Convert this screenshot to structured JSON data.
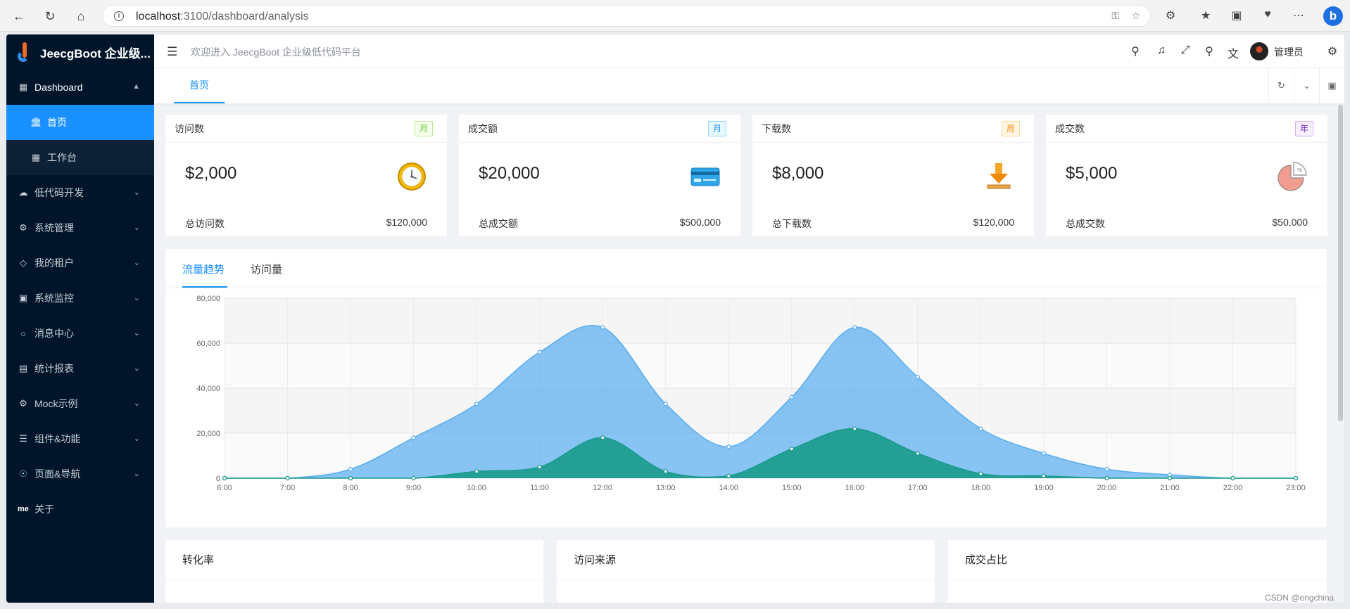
{
  "browser": {
    "url_host": "localhost",
    "url_path": ":3100/dashboard/analysis"
  },
  "app": {
    "title": "JeecgBoot 企业级...",
    "welcome": "欢迎进入 JeecgBoot 企业级低代码平台",
    "user_name": "管理员"
  },
  "sidebar": {
    "dashboard": {
      "label": "Dashboard",
      "children": [
        {
          "label": "首页",
          "icon": "bank-icon",
          "active": true
        },
        {
          "label": "工作台",
          "icon": "grid-icon",
          "active": false
        }
      ]
    },
    "items": [
      {
        "label": "低代码开发",
        "icon": "cloud-icon"
      },
      {
        "label": "系统管理",
        "icon": "gear-icon"
      },
      {
        "label": "我的租户",
        "icon": "diamond-icon"
      },
      {
        "label": "系统监控",
        "icon": "video-icon"
      },
      {
        "label": "消息中心",
        "icon": "message-icon"
      },
      {
        "label": "统计报表",
        "icon": "bar-chart-icon"
      },
      {
        "label": "Mock示例",
        "icon": "gear-icon"
      },
      {
        "label": "组件&功能",
        "icon": "layers-icon"
      },
      {
        "label": "页面&导航",
        "icon": "settings-icon"
      }
    ],
    "about": {
      "label": "关于",
      "mark": "me"
    }
  },
  "tabs": [
    {
      "label": "首页",
      "active": true
    }
  ],
  "stats": [
    {
      "title": "访问数",
      "tag": "月",
      "tag_color": "green",
      "value": "$2,000",
      "icon": "clock-icon",
      "footer_label": "总访问数",
      "footer_value": "$120,000"
    },
    {
      "title": "成交额",
      "tag": "月",
      "tag_color": "blue",
      "value": "$20,000",
      "icon": "credit-card-icon",
      "footer_label": "总成交额",
      "footer_value": "$500,000"
    },
    {
      "title": "下载数",
      "tag": "周",
      "tag_color": "orange",
      "value": "$8,000",
      "icon": "download-icon",
      "footer_label": "总下载数",
      "footer_value": "$120,000"
    },
    {
      "title": "成交数",
      "tag": "年",
      "tag_color": "purple",
      "value": "$5,000",
      "icon": "pie-chart-icon",
      "footer_label": "总成交数",
      "footer_value": "$50,000"
    }
  ],
  "chart_tabs": [
    {
      "label": "流量趋势",
      "active": true
    },
    {
      "label": "访问量",
      "active": false
    }
  ],
  "chart_data": {
    "type": "area",
    "x": [
      "6:00",
      "7:00",
      "8:00",
      "9:00",
      "10:00",
      "11:00",
      "12:00",
      "13:00",
      "14:00",
      "15:00",
      "16:00",
      "17:00",
      "18:00",
      "19:00",
      "20:00",
      "21:00",
      "22:00",
      "23:00"
    ],
    "ylim": [
      0,
      80000
    ],
    "yticks": [
      0,
      20000,
      40000,
      60000,
      80000
    ],
    "ytick_labels": [
      "0",
      "20,000",
      "40,000",
      "60,000",
      "80,000"
    ],
    "grid": true,
    "series": [
      {
        "values": [
          0,
          0,
          4000,
          18000,
          33000,
          56000,
          67000,
          33000,
          14000,
          36000,
          67000,
          45000,
          22000,
          11000,
          4000,
          1500,
          0,
          0
        ],
        "color": "#5aaef0"
      },
      {
        "values": [
          0,
          0,
          0,
          0,
          3000,
          5000,
          18000,
          3000,
          1000,
          13000,
          22000,
          11000,
          2000,
          1000,
          0,
          0,
          0,
          0
        ],
        "color": "#1a9b8c"
      }
    ]
  },
  "bottom_cards": [
    {
      "title": "转化率"
    },
    {
      "title": "访问来源"
    },
    {
      "title": "成交占比"
    }
  ],
  "watermark": "CSDN @engchina"
}
